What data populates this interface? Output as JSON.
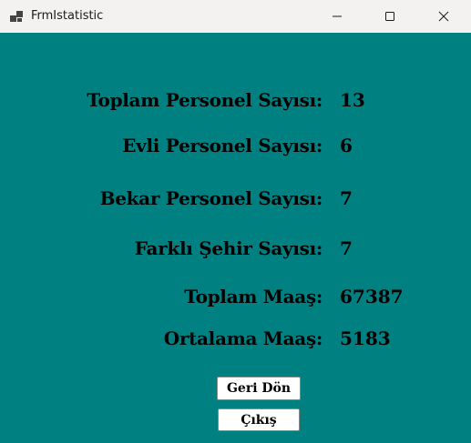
{
  "window": {
    "title": "FrmIstatistic"
  },
  "stats": [
    {
      "label": "Toplam Personel Sayısı:",
      "value": "13"
    },
    {
      "label": "Evli Personel Sayısı:",
      "value": "6"
    },
    {
      "label": "Bekar Personel Sayısı:",
      "value": "7"
    },
    {
      "label": "Farklı Şehir Sayısı:",
      "value": "7"
    },
    {
      "label": "Toplam Maaş:",
      "value": "67387"
    },
    {
      "label": "Ortalama Maaş:",
      "value": "5183"
    }
  ],
  "buttons": {
    "back_label": "Geri Dön",
    "exit_label": "Çıkış"
  },
  "colors": {
    "background": "#008080",
    "titlebar": "#f3f2f0"
  }
}
